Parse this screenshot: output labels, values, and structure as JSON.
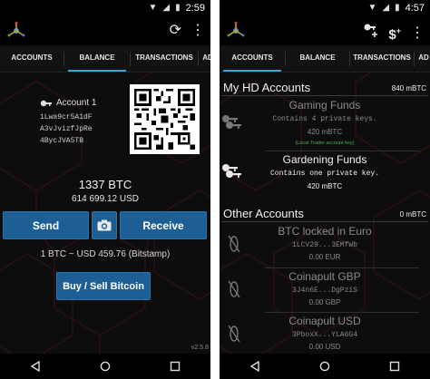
{
  "left_screen": {
    "status_time": "2:59",
    "tabs": [
      {
        "label": "ACCOUNTS",
        "active": false
      },
      {
        "label": "BALANCE",
        "active": true
      },
      {
        "label": "TRANSACTIONS",
        "active": false
      },
      {
        "label": "AD",
        "active": false
      }
    ],
    "account_label": "Account 1",
    "address_lines": [
      "1Lwa9cr5A1dF",
      "A3vJvizfJpRe",
      "4BycJVA5TB"
    ],
    "balance_btc": "1337 BTC",
    "balance_fiat": "614 699.12 USD",
    "send_label": "Send",
    "receive_label": "Receive",
    "rate_text": "1 BTC ~ USD 459.76 (Bitstamp)",
    "buy_sell_label": "Buy / Sell Bitcoin",
    "version": "v2.5.8",
    "icons": {
      "refresh": "refresh-icon",
      "menu": "overflow-menu-icon",
      "camera": "camera-icon"
    }
  },
  "right_screen": {
    "status_time": "4:57",
    "tabs": [
      {
        "label": "ACCOUNTS",
        "active": true
      },
      {
        "label": "BALANCE",
        "active": false
      },
      {
        "label": "TRANSACTIONS",
        "active": false
      },
      {
        "label": "AD",
        "active": false
      }
    ],
    "hd_section": {
      "title": "My HD Accounts",
      "total": "840 mBTC",
      "accounts": [
        {
          "name": "Gaming Funds",
          "detail": "Contains 4 private keys.",
          "amount": "420 mBTC",
          "tag": "(Local Trader account key)",
          "active": false
        },
        {
          "name": "Gardening Funds",
          "detail": "Contains one private key.",
          "amount": "420 mBTC",
          "tag": "",
          "active": true
        }
      ]
    },
    "other_section": {
      "title": "Other Accounts",
      "total": "0 mBTC",
      "accounts": [
        {
          "name": "BTC locked in Euro",
          "detail": "1LCV29...3EMfWb",
          "amount": "0.00 EUR"
        },
        {
          "name": "Coinapult GBP",
          "detail": "3J4n6E...DgPziS",
          "amount": "0.00 GBP"
        },
        {
          "name": "Coinapult USD",
          "detail": "3PboxX...YLA6G4",
          "amount": "0.00 USD"
        }
      ]
    },
    "icons": {
      "add_key": "add-key-icon",
      "add_dollar": "add-dollar-icon",
      "menu": "overflow-menu-icon"
    }
  },
  "colors": {
    "accent_blue": "#1d5f95",
    "tab_indicator": "#3da0d8",
    "background": "#0d0d0d",
    "tag_green": "#4caf50"
  }
}
